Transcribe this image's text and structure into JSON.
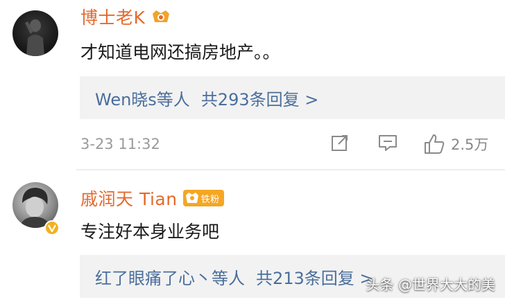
{
  "comments": [
    {
      "username": "博士老K",
      "text": "才知道电网还搞房地产。。",
      "reply_users": "Wen晓s等人",
      "reply_count": "共293条回复 >",
      "timestamp": "3-23 11:32",
      "likes": "2.5万"
    },
    {
      "username": "戚润天 Tian",
      "fan_badge": "铁粉",
      "text": "专注好本身业务吧",
      "reply_users": "红了眼痛了心丶等人",
      "reply_count": "共213条回复 >"
    }
  ],
  "watermark": "头条 @世界大大的美",
  "icons": {
    "share": "share-edit-icon",
    "reply": "comment-icon",
    "like": "thumbs-up-icon",
    "verified": "verified-v-icon",
    "badge": "crown-badge-icon"
  },
  "colors": {
    "username": "#e46a2c",
    "reply_link": "#4a6e9c",
    "reply_bg": "#f2f2f2",
    "meta": "#9a9a9a"
  }
}
